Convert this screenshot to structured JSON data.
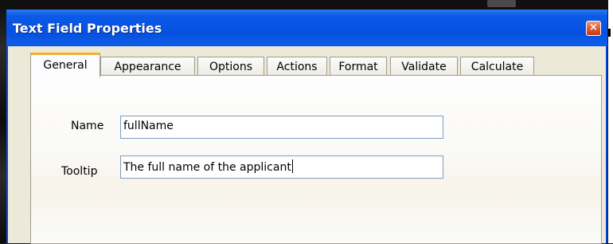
{
  "dialog": {
    "title": "Text Field Properties",
    "close_symbol": "×"
  },
  "tabs": [
    {
      "label": "General",
      "active": true
    },
    {
      "label": "Appearance",
      "active": false
    },
    {
      "label": "Options",
      "active": false
    },
    {
      "label": "Actions",
      "active": false
    },
    {
      "label": "Format",
      "active": false
    },
    {
      "label": "Validate",
      "active": false
    },
    {
      "label": "Calculate",
      "active": false
    }
  ],
  "general": {
    "name_label": "Name",
    "name_value": "fullName",
    "tooltip_label": "Tooltip",
    "tooltip_value": "The full name of the applicant"
  },
  "colors": {
    "titlebar": "#0750e0",
    "active_tab_accent": "#f3b02e",
    "close_button": "#d8532e"
  }
}
